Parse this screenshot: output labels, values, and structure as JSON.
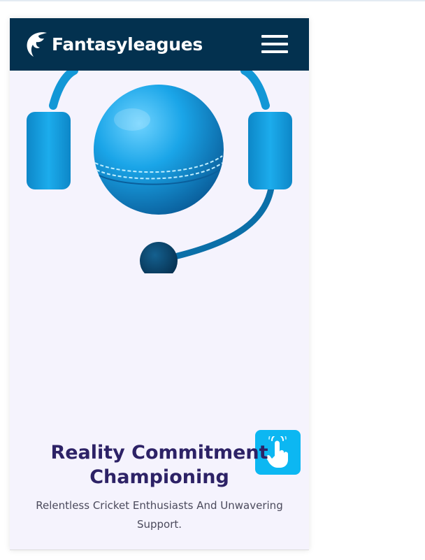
{
  "header": {
    "brand_name": "Fantasyleagues",
    "logo_icon": "fantasyleagues-logo-icon",
    "menu_icon": "hamburger-menu-icon"
  },
  "hero": {
    "illustration_icon": "cricket-ball-headset-icon",
    "title": "Reality Commitment Championing",
    "subtitle": "Relentless Cricket Enthusiasts And Unwavering Support.",
    "support_button_icon": "pointing-hand-icon"
  },
  "colors": {
    "navbar": "#03314f",
    "page_background": "#f5f3fd",
    "title": "#2d2266",
    "subtitle": "#4b4a5c",
    "accent": "#0cb7f2"
  }
}
